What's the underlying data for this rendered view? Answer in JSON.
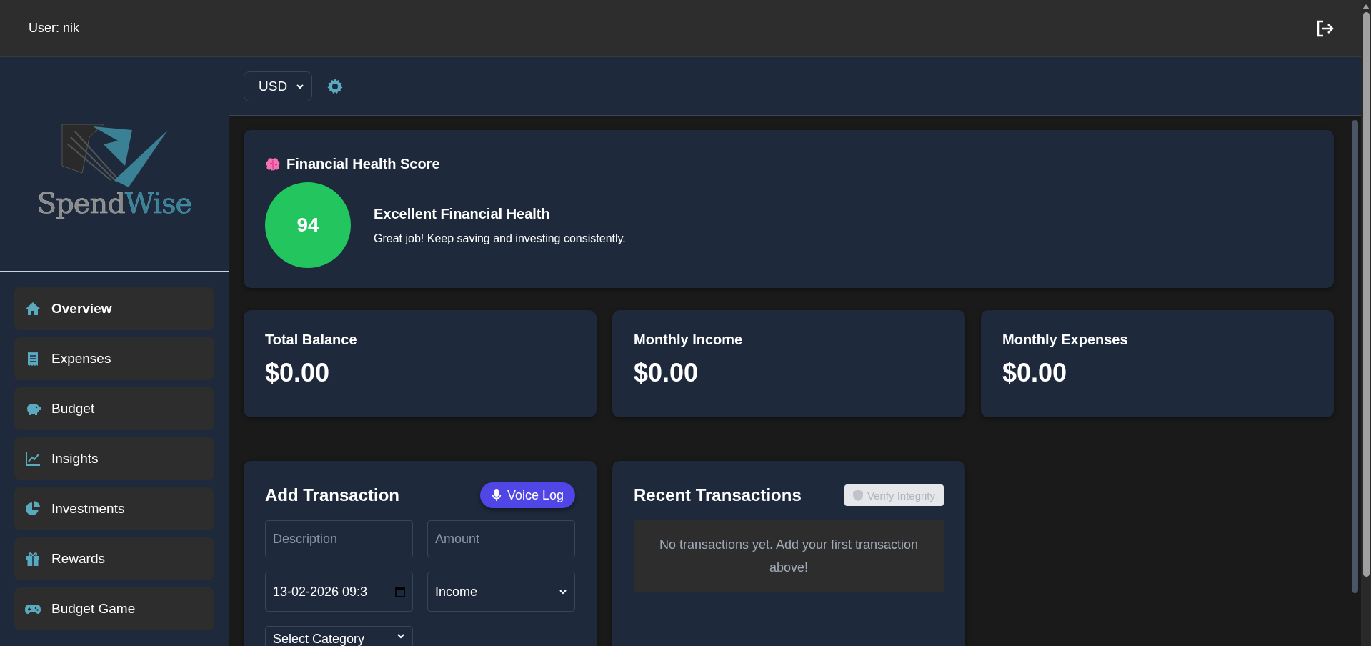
{
  "header": {
    "user_label": "User: nik"
  },
  "logo": {
    "part_1": "Spend",
    "part_2": "Wise"
  },
  "sidebar": {
    "items": [
      {
        "label": "Overview",
        "selected": true
      },
      {
        "label": "Expenses",
        "selected": false
      },
      {
        "label": "Budget",
        "selected": false
      },
      {
        "label": "Insights",
        "selected": false
      },
      {
        "label": "Investments",
        "selected": false
      },
      {
        "label": "Rewards",
        "selected": false
      },
      {
        "label": "Budget Game",
        "selected": false
      }
    ]
  },
  "toolbar": {
    "currency": "USD"
  },
  "health_card": {
    "title": "Financial Health Score",
    "score": "94",
    "heading": "Excellent Financial Health",
    "message": "Great job! Keep saving and investing consistently."
  },
  "stats": [
    {
      "label": "Total Balance",
      "value": "$0.00"
    },
    {
      "label": "Monthly Income",
      "value": "$0.00"
    },
    {
      "label": "Monthly Expenses",
      "value": "$0.00"
    }
  ],
  "add_transaction": {
    "title": "Add Transaction",
    "voice_button": "Voice Log",
    "fields": [
      {
        "kind": "input",
        "placeholder": "Description"
      },
      {
        "kind": "input",
        "placeholder": "Amount"
      },
      {
        "kind": "date",
        "value": "13-02-2026 09:3"
      },
      {
        "kind": "select",
        "value": "Income"
      },
      {
        "kind": "select",
        "value": "Select Category"
      }
    ]
  },
  "recent_transactions": {
    "title": "Recent Transactions",
    "verify_button": {
      "label": "Verify Integrity",
      "disabled": true
    },
    "empty_message": "No transactions yet. Add your first transaction above!"
  }
}
